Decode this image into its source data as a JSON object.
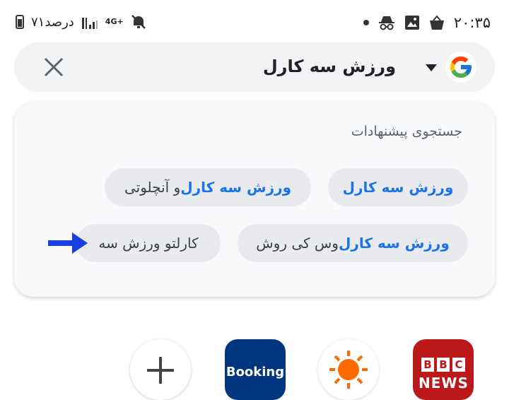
{
  "status_bar": {
    "time": "۲۰:۳۵",
    "battery_text": "۷۱درصد",
    "network": "4G+"
  },
  "search": {
    "query": "ورزش سه کارل"
  },
  "suggestions": {
    "title": "جستجوی پیشنهادات",
    "chips": [
      {
        "highlight": "ورزش سه کارل",
        "rest": ""
      },
      {
        "highlight": "ورزش سه کارل",
        "rest": "و آنچلوتی"
      },
      {
        "highlight": "ورزش سه کارل",
        "rest": "وس کی روش"
      },
      {
        "highlight": "",
        "rest": "کارلتو ورزش سه"
      }
    ]
  },
  "shortcuts": {
    "booking_label": "Booking",
    "bbc_letters": [
      "B",
      "B",
      "C"
    ],
    "bbc_news": "NEWS"
  },
  "colors": {
    "accent": "#1a73e8",
    "arrow": "#1a3fe0",
    "booking": "#003580",
    "bbc": "#bb1919"
  }
}
